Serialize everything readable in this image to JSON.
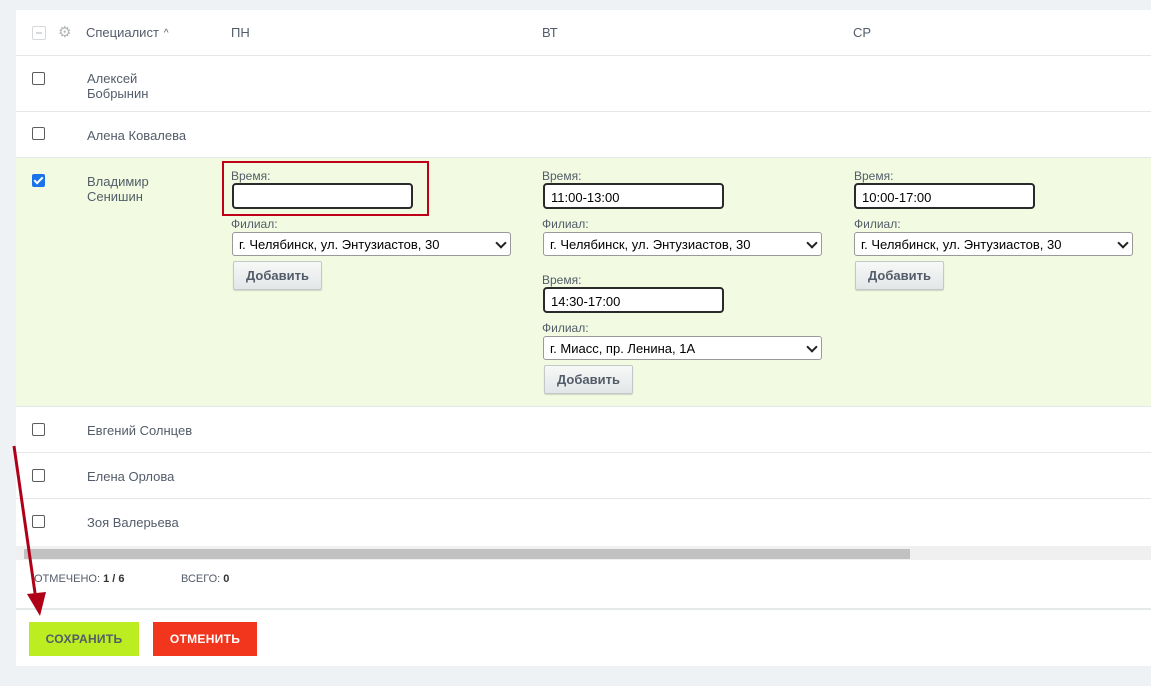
{
  "header": {
    "specialist_label": "Специалист",
    "days": [
      "ПН",
      "ВТ",
      "СР"
    ]
  },
  "rows": [
    {
      "name_line1": "Алексей",
      "name_line2": "Бобрынин",
      "checked": false
    },
    {
      "name_line1": "Алена Ковалева",
      "name_line2": "",
      "checked": false
    },
    {
      "name_line1": "Владимир",
      "name_line2": "Сенишин",
      "checked": true
    },
    {
      "name_line1": "Евгений Солнцев",
      "name_line2": "",
      "checked": false
    },
    {
      "name_line1": "Елена Орлова",
      "name_line2": "",
      "checked": false
    },
    {
      "name_line1": "Зоя Валерьева",
      "name_line2": "",
      "checked": false
    }
  ],
  "schedule": {
    "time_label": "Время:",
    "branch_label": "Филиал:",
    "add_label": "Добавить",
    "mon": {
      "time": "",
      "branch": "г. Челябинск, ул. Энтузиастов, 30"
    },
    "tue": [
      {
        "time": "11:00-13:00",
        "branch": "г. Челябинск, ул. Энтузиастов, 30"
      },
      {
        "time": "14:30-17:00",
        "branch": "г. Миасс, пр. Ленина, 1А"
      }
    ],
    "wed": {
      "time": "10:00-17:00",
      "branch": "г. Челябинск, ул. Энтузиастов, 30"
    }
  },
  "footer": {
    "selected_label": "ОТМЕЧЕНО:",
    "selected_value": "1 / 6",
    "total_label": "ВСЕГО:",
    "total_value": "0"
  },
  "actions": {
    "save_label": "СОХРАНИТЬ",
    "cancel_label": "ОТМЕНИТЬ"
  },
  "colors": {
    "save": "#bbed21",
    "cancel": "#f1361d",
    "selected_row": "#f2fbe1",
    "highlight": "#c00018"
  }
}
